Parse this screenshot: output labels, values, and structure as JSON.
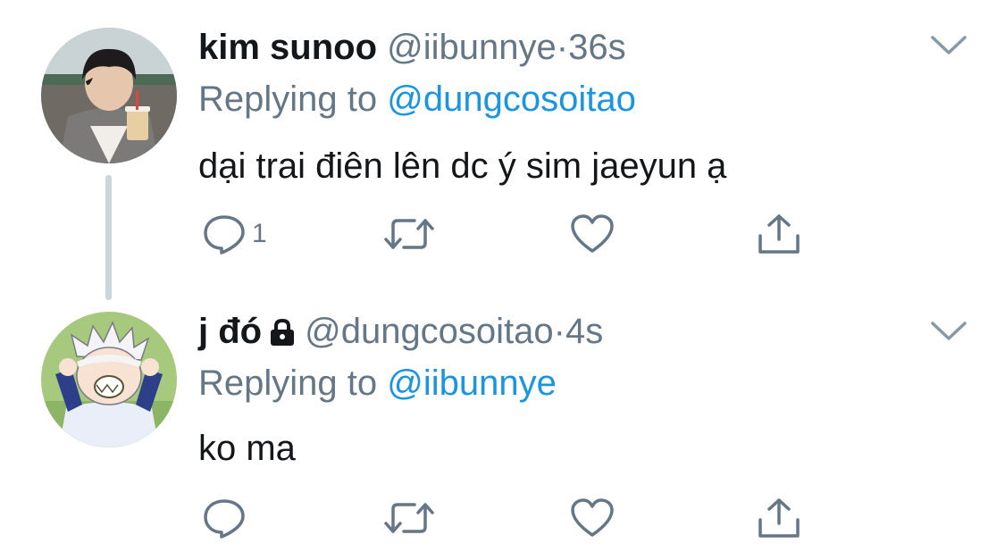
{
  "tweets": [
    {
      "display_name": "kim sunoo",
      "handle": "@iibunnye",
      "separator": "·",
      "time": "36s",
      "replying_prefix": "Replying to",
      "replying_to": "@dungcosoitao",
      "text": "dại trai điên lên dc ý sim jaeyun ạ",
      "reply_count": "1",
      "protected": false
    },
    {
      "display_name": "j đó",
      "handle": "@dungcosoitao",
      "separator": "·",
      "time": "4s",
      "replying_prefix": "Replying to",
      "replying_to": "@iibunnye",
      "text": "ko ma",
      "reply_count": "",
      "protected": true
    }
  ],
  "icons": {
    "reply": "reply-icon",
    "retweet": "retweet-icon",
    "like": "heart-icon",
    "share": "share-icon",
    "menu": "chevron-down-icon",
    "protected": "lock-icon"
  },
  "colors": {
    "text": "#14171a",
    "secondary": "#657786",
    "link": "#1b95e0",
    "thread_line": "#ccd6dd"
  }
}
